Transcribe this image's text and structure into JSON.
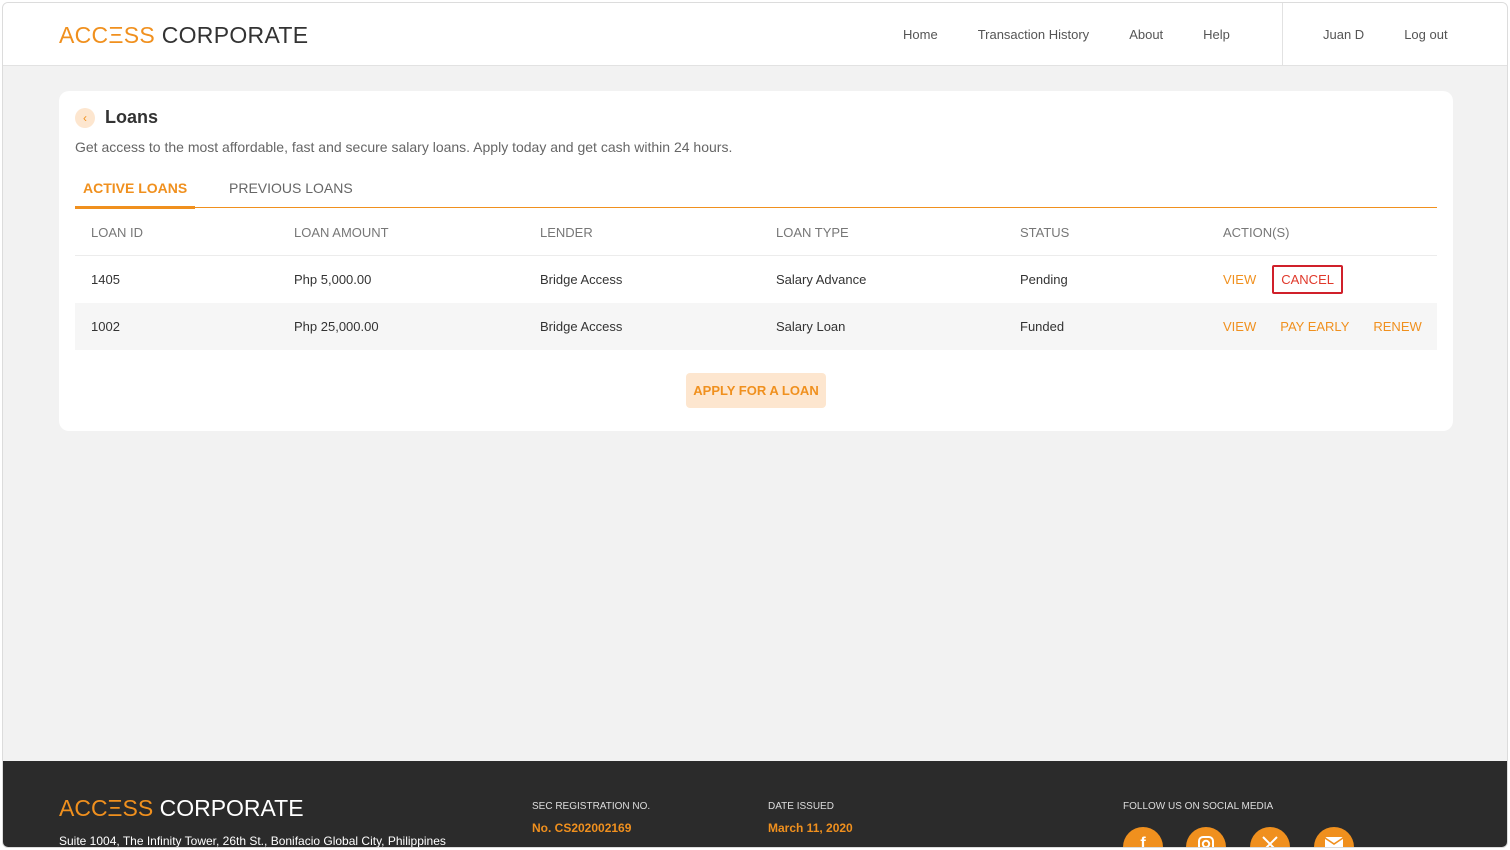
{
  "brand": {
    "logo_primary": "ACCΞSS",
    "logo_secondary": "CORPORATE"
  },
  "nav": {
    "main": [
      "Home",
      "Transaction History",
      "About",
      "Help"
    ],
    "user_name": "Juan D",
    "logout": "Log out"
  },
  "page": {
    "back_icon": "‹",
    "title": "Loans",
    "subtitle": "Get access to the most affordable, fast and secure salary loans. Apply today and get cash within 24 hours."
  },
  "tabs": {
    "active": "ACTIVE LOANS",
    "previous": "PREVIOUS LOANS"
  },
  "table": {
    "headers": [
      "LOAN ID",
      "LOAN AMOUNT",
      "LENDER",
      "LOAN TYPE",
      "STATUS",
      "ACTION(S)"
    ],
    "rows": [
      {
        "loan_id": "1405",
        "amount": "Php 5,000.00",
        "lender": "Bridge Access",
        "type": "Salary Advance",
        "status": "Pending",
        "actions": [
          "VIEW",
          "CANCEL"
        ]
      },
      {
        "loan_id": "1002",
        "amount": "Php 25,000.00",
        "lender": "Bridge Access",
        "type": "Salary Loan",
        "status": "Funded",
        "actions": [
          "VIEW",
          "PAY EARLY",
          "RENEW"
        ]
      }
    ]
  },
  "apply_button": "APPLY FOR A LOAN",
  "footer": {
    "address": "Suite 1004, The Infinity Tower, 26th St., Bonifacio Global City, Philippines",
    "sec_label": "SEC REGISTRATION NO.",
    "sec_value": "No. CS202002169",
    "date_label": "DATE ISSUED",
    "date_value": "March 11, 2020",
    "social_label": "FOLLOW US ON SOCIAL MEDIA",
    "social_icons": [
      "facebook-icon",
      "instagram-icon",
      "x-icon",
      "email-icon"
    ]
  },
  "colors": {
    "accent": "#f0901e",
    "cancel_highlight": "#d0202a",
    "footer_bg": "#2b2b2b"
  }
}
